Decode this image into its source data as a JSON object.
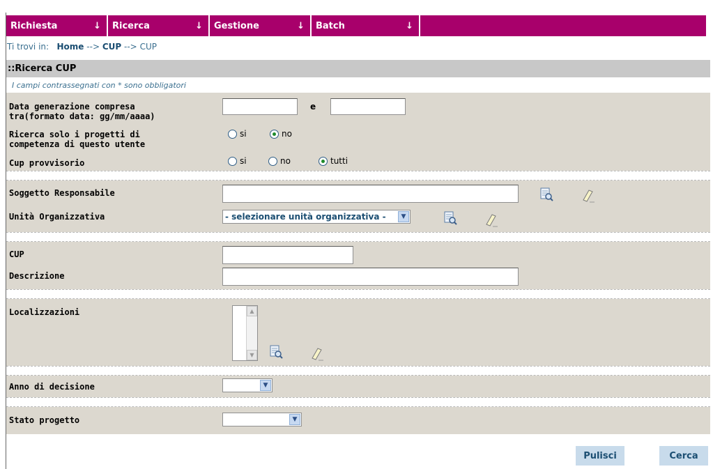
{
  "menu": [
    {
      "label": "Richiesta",
      "arrow": "↓"
    },
    {
      "label": "Ricerca",
      "arrow": "↓"
    },
    {
      "label": "Gestione",
      "arrow": "↓"
    },
    {
      "label": "Batch",
      "arrow": "↓"
    }
  ],
  "breadcrumb": {
    "prefix": "Ti trovi in:",
    "home": "Home",
    "sep": "-->",
    "cup_link": "CUP",
    "current": "CUP"
  },
  "page_title": "::Ricerca CUP",
  "required_note": "I campi contrassegnati con * sono obbligatori",
  "form": {
    "data_label_1": "Data generazione compresa",
    "data_label_2": "tra(formato data: gg/mm/aaaa)",
    "data_and": "e",
    "competenza_label_1": "Ricerca solo i progetti di",
    "competenza_label_2": "competenza di questo utente",
    "competenza_options": [
      "si",
      "no"
    ],
    "competenza_selected": "no",
    "provvisorio_label": "Cup provvisorio",
    "provvisorio_options": [
      "si",
      "no",
      "tutti"
    ],
    "provvisorio_selected": "tutti",
    "soggetto_label": "Soggetto Responsabile",
    "unita_label": "Unità Organizzativa",
    "unita_select": "- selezionare unità organizzativa -",
    "cup_label": "CUP",
    "descrizione_label": "Descrizione",
    "localizzazioni_label": "Localizzazioni",
    "anno_label": "Anno di decisione",
    "stato_label": "Stato progetto"
  },
  "buttons": {
    "pulisci": "Pulisci",
    "cerca": "Cerca"
  },
  "colors": {
    "menu_bg": "#a8006b",
    "form_bg": "#dcd8cf",
    "title_bg": "#c8c8c8",
    "button_bg": "#c8dbeb"
  },
  "icons": {
    "lookup": "search-document-icon",
    "clear": "eraser-icon",
    "dropdown": "chevron-down-icon"
  }
}
